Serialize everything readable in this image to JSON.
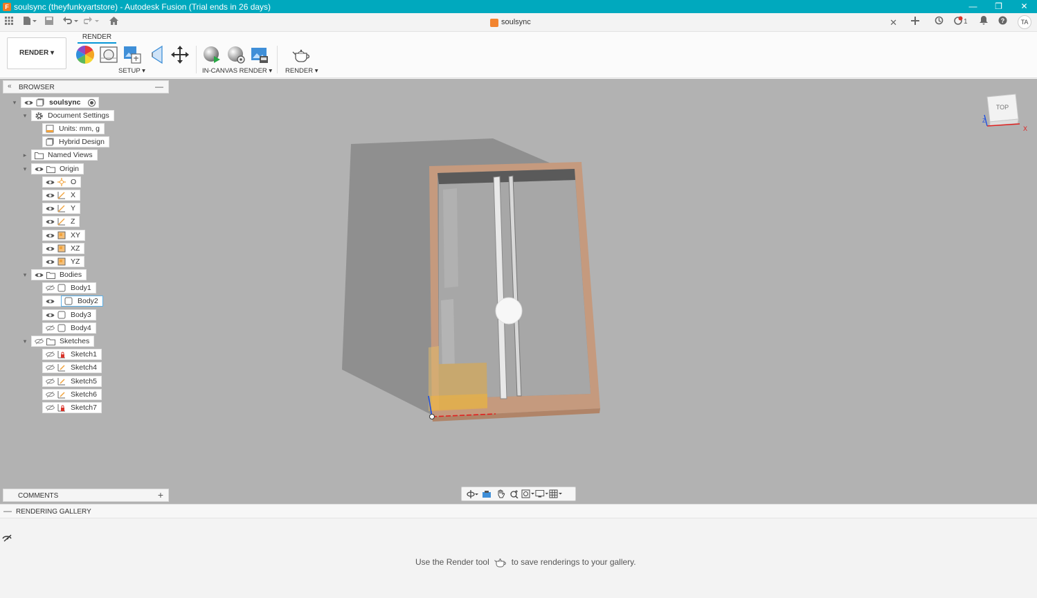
{
  "title_bar": {
    "title": "soulsync (theyfunkyartstore) - Autodesk Fusion (Trial ends in 26 days)",
    "app_icon": "F"
  },
  "window_controls": {
    "minimize": "—",
    "restore": "❐",
    "close": "✕"
  },
  "document_tab": {
    "title": "soulsync",
    "close": "✕"
  },
  "header_right": {
    "notifications_badge": "1",
    "user_initials": "TA"
  },
  "ribbon": {
    "workspace": "RENDER",
    "active_tab": "RENDER",
    "groups": {
      "setup": "SETUP",
      "in_canvas_render": "IN-CANVAS RENDER",
      "render": "RENDER"
    }
  },
  "browser": {
    "header": "BROWSER",
    "root": "soulsync",
    "items": {
      "document_settings": "Document Settings",
      "units": "Units: mm, g",
      "hybrid_design": "Hybrid Design",
      "named_views": "Named Views",
      "origin": "Origin",
      "origin_o": "O",
      "origin_x": "X",
      "origin_y": "Y",
      "origin_z": "Z",
      "origin_xy": "XY",
      "origin_xz": "XZ",
      "origin_yz": "YZ",
      "bodies": "Bodies",
      "body1": "Body1",
      "body2": "Body2",
      "body3": "Body3",
      "body4": "Body4",
      "sketches": "Sketches",
      "sketch1": "Sketch1",
      "sketch4": "Sketch4",
      "sketch5": "Sketch5",
      "sketch6": "Sketch6",
      "sketch7": "Sketch7"
    }
  },
  "viewcube": {
    "face": "TOP",
    "axis_x": "X",
    "axis_z": "Z"
  },
  "comments": {
    "label": "COMMENTS",
    "add": "+"
  },
  "rendering_gallery": {
    "header": "RENDERING GALLERY",
    "message_before": "Use the Render tool",
    "message_after": "to save renderings to your gallery."
  },
  "colors": {
    "title_bar": "#00a9be",
    "canvas": "#b2b2b2",
    "frame_wood": "#c59a7e",
    "selection_blue": "#0696d7"
  }
}
